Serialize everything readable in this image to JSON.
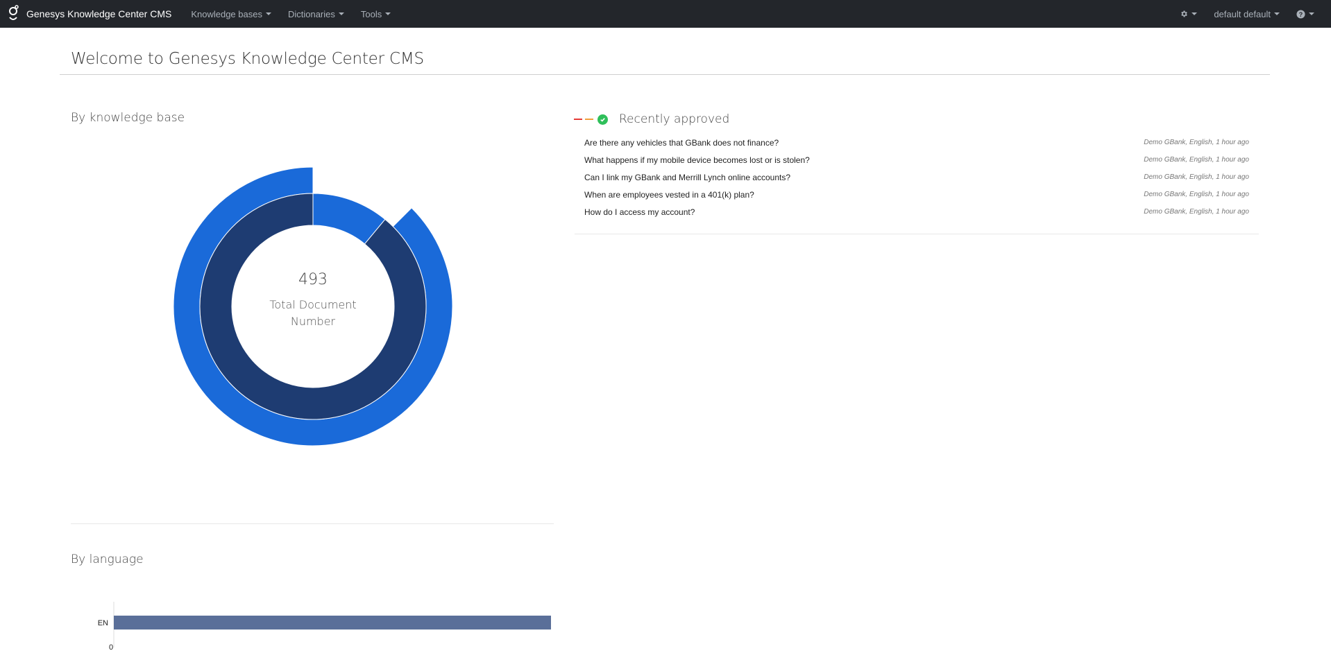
{
  "navbar": {
    "brand": "Genesys Knowledge Center CMS",
    "menus": [
      "Knowledge bases",
      "Dictionaries",
      "Tools"
    ],
    "user": "default default",
    "settings_icon": "gear-icon",
    "help_icon": "question-circle-icon",
    "bg_color": "#23262b"
  },
  "page": {
    "title": "Welcome to Genesys Knowledge Center CMS"
  },
  "by_kb": {
    "title": "By knowledge base",
    "total": "493",
    "total_label": "Total Document Number"
  },
  "by_language": {
    "title": "By language"
  },
  "recently_approved": {
    "title": "Recently approved",
    "items": [
      {
        "question": "Are there any vehicles that GBank does not finance?",
        "meta": "Demo GBank, English, 1 hour ago"
      },
      {
        "question": "What happens if my mobile device becomes lost or is stolen?",
        "meta": "Demo GBank, English, 1 hour ago"
      },
      {
        "question": "Can I link my GBank and Merrill Lynch online accounts?",
        "meta": "Demo GBank, English, 1 hour ago"
      },
      {
        "question": "When are employees vested in a 401(k) plan?",
        "meta": "Demo GBank, English, 1 hour ago"
      },
      {
        "question": "How do I access my account?",
        "meta": "Demo GBank, English, 1 hour ago"
      }
    ]
  },
  "chart_data": [
    {
      "type": "pie",
      "rings": [
        {
          "ring": "outer",
          "color": "#1a6ad9",
          "slices": [
            {
              "value": 0.125
            },
            {
              "value": 0.875
            }
          ]
        },
        {
          "ring": "inner",
          "slices": [
            {
              "value": 0.11,
              "color": "#1a6ad9"
            },
            {
              "value": 0.89,
              "color": "#1e3c72"
            }
          ]
        }
      ],
      "center_value": "493",
      "center_label": "Total Document Number"
    },
    {
      "type": "bar",
      "orientation": "horizontal",
      "categories": [
        "EN"
      ],
      "values": [
        493
      ],
      "xlim": [
        0,
        493
      ],
      "tick_labels": [
        "0"
      ],
      "bar_color": "#5a6f99"
    }
  ]
}
